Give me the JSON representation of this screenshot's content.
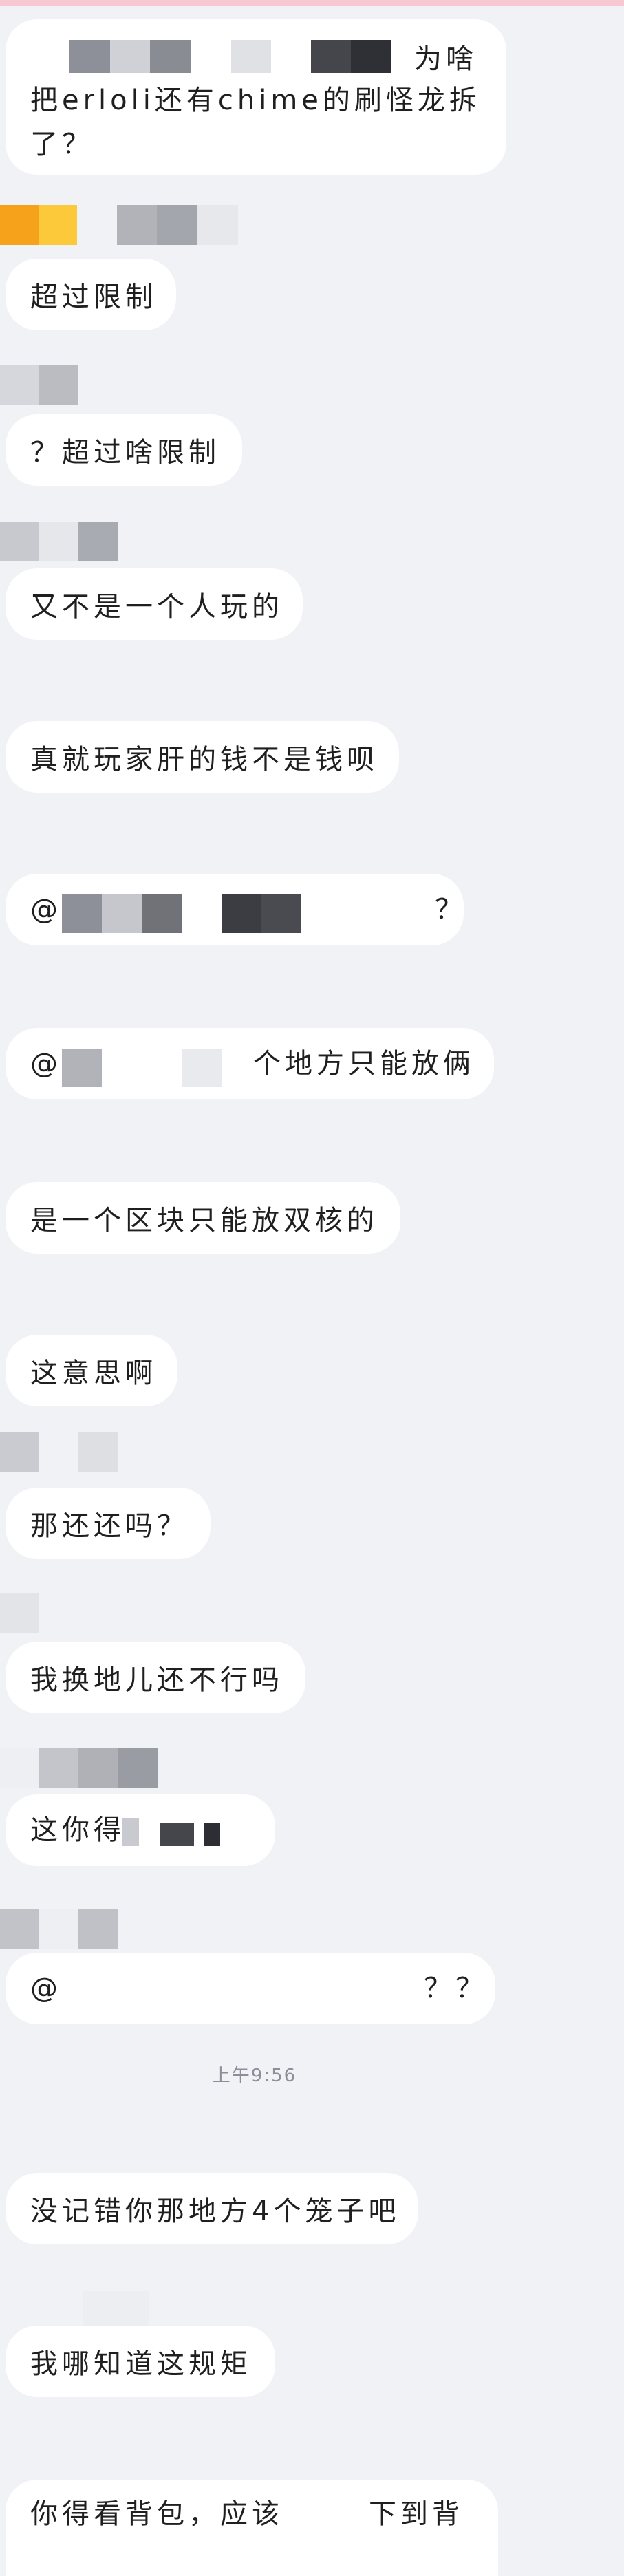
{
  "messages": [
    {
      "text_a": "为啥",
      "text_b": "把erloli还有chime的刷怪龙拆",
      "text_c": "了？"
    },
    {
      "text": "超过限制"
    },
    {
      "text": "？超过啥限制"
    },
    {
      "text": "又不是一个人玩的"
    },
    {
      "text": "真就玩家肝的钱不是钱呗"
    },
    {
      "prefix": "@",
      "suffix": "？"
    },
    {
      "prefix": "@",
      "suffix": "个地方只能放俩"
    },
    {
      "text": "是一个区块只能放双核的"
    },
    {
      "text": "这意思啊"
    },
    {
      "text": "那还还吗？"
    },
    {
      "text": "我换地儿还不行吗"
    },
    {
      "prefix": "这你得"
    },
    {
      "prefix": "@",
      "suffix": "？？"
    },
    {
      "text": "没记错你那地方4个笼子吧"
    },
    {
      "text": "我哪知道这规矩"
    },
    {
      "text_a": "你得看背包，应该",
      "text_b": "下到背"
    }
  ],
  "timestamp": "上午9:56",
  "colors": {
    "background": "#f1f2f6",
    "bubble": "#ffffff",
    "text": "#1f1f1f",
    "accent_orange": "#f7a21b",
    "accent_yellow": "#fcc93a"
  }
}
